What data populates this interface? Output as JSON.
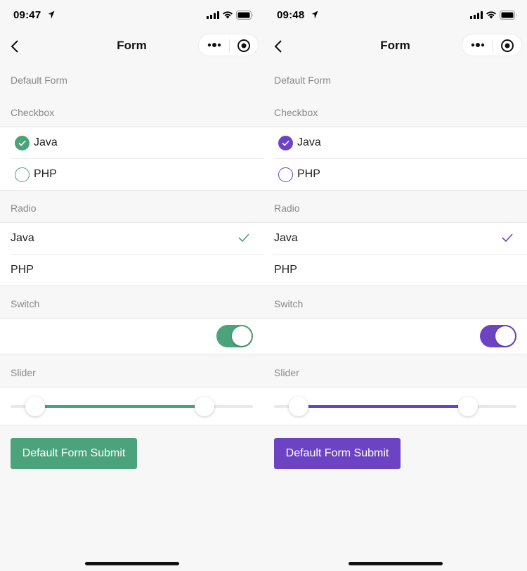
{
  "screens": [
    {
      "time": "09:47",
      "nav_title": "Form",
      "accent": "#4aa37a",
      "section_title": "Default Form",
      "checkbox": {
        "label": "Checkbox",
        "options": [
          {
            "label": "Java",
            "checked": true
          },
          {
            "label": "PHP",
            "checked": false
          }
        ]
      },
      "radio": {
        "label": "Radio",
        "options": [
          {
            "label": "Java",
            "selected": true
          },
          {
            "label": "PHP",
            "selected": false
          }
        ]
      },
      "switch": {
        "label": "Switch",
        "on": true
      },
      "slider": {
        "label": "Slider",
        "range": [
          0.1,
          0.8
        ]
      },
      "submit_label": "Default Form Submit"
    },
    {
      "time": "09:48",
      "nav_title": "Form",
      "accent": "#6c44c3",
      "section_title": "Default Form",
      "checkbox": {
        "label": "Checkbox",
        "options": [
          {
            "label": "Java",
            "checked": true
          },
          {
            "label": "PHP",
            "checked": false
          }
        ]
      },
      "radio": {
        "label": "Radio",
        "options": [
          {
            "label": "Java",
            "selected": true
          },
          {
            "label": "PHP",
            "selected": false
          }
        ]
      },
      "switch": {
        "label": "Switch",
        "on": true
      },
      "slider": {
        "label": "Slider",
        "range": [
          0.1,
          0.8
        ]
      },
      "submit_label": "Default Form Submit"
    }
  ],
  "icons": {
    "back": "chevron-left-icon",
    "more": "more-dots-icon",
    "close": "target-circle-icon",
    "signal": "cellular-signal-icon",
    "wifi": "wifi-icon",
    "battery": "battery-icon",
    "location": "location-arrow-icon"
  }
}
